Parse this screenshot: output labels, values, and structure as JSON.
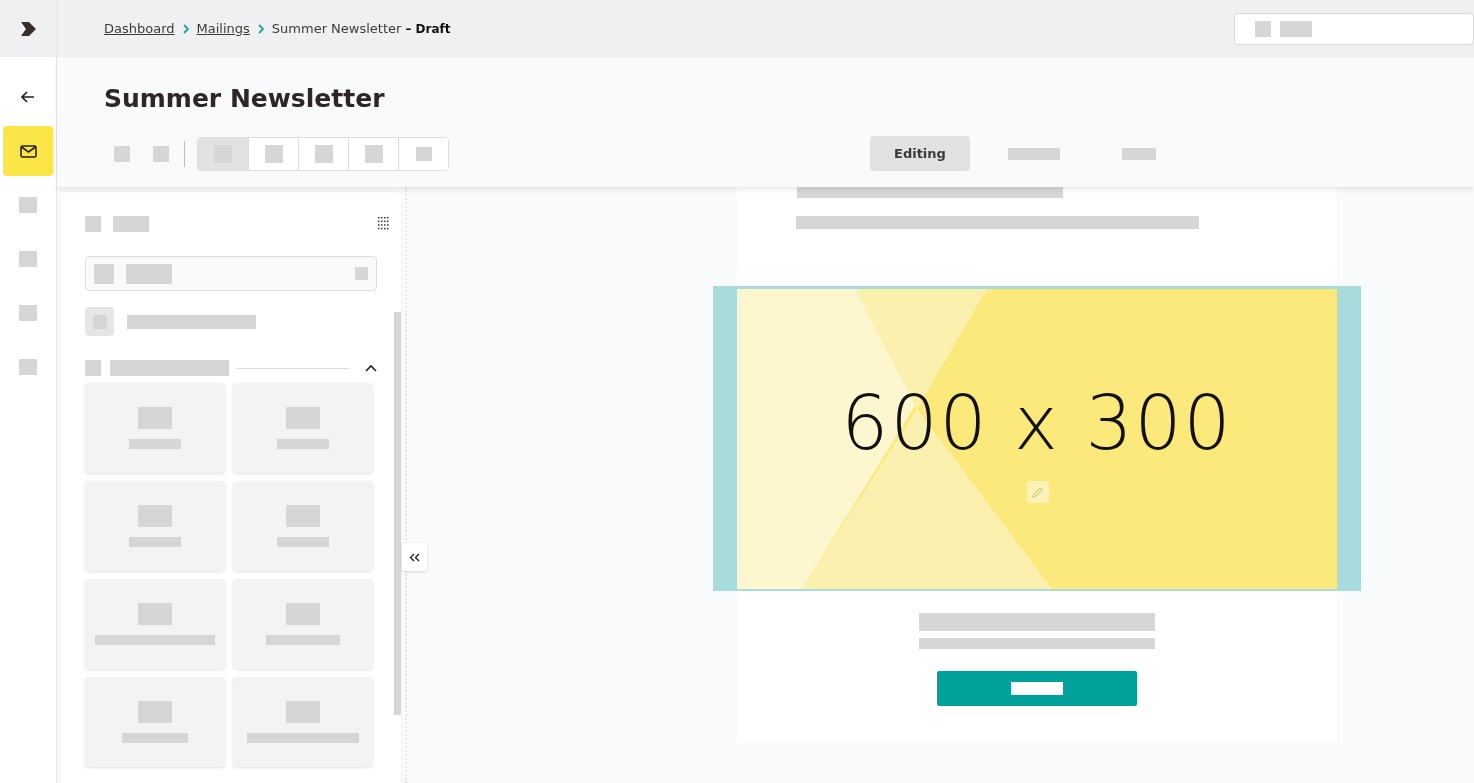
{
  "breadcrumb": {
    "links": [
      "Dashboard",
      "Mailings"
    ],
    "current": "Summer Newsletter",
    "status": "– Draft"
  },
  "rail": {
    "items": [
      {
        "kind": "back",
        "selected": false
      },
      {
        "kind": "mail",
        "selected": true
      },
      {
        "kind": "block",
        "selected": false
      },
      {
        "kind": "block",
        "selected": false
      },
      {
        "kind": "block",
        "selected": false
      },
      {
        "kind": "block",
        "selected": false
      }
    ]
  },
  "title": "Summer Newsletter",
  "segments": [
    {
      "selected": true
    },
    {
      "selected": false
    },
    {
      "selected": false
    },
    {
      "selected": false
    },
    {
      "selected": false
    }
  ],
  "tabs": [
    {
      "label": "Editing",
      "selected": true
    },
    {
      "selected": false
    },
    {
      "selected": false
    }
  ],
  "panel": {
    "option": {
      "checked": false
    },
    "section": {
      "expanded": true
    },
    "tiles": [
      {
        "kind": "tile"
      },
      {
        "kind": "tile"
      },
      {
        "kind": "tile"
      },
      {
        "kind": "tile"
      },
      {
        "kind": "tile"
      },
      {
        "kind": "tile"
      },
      {
        "kind": "tile"
      },
      {
        "kind": "tile"
      }
    ]
  },
  "canvas": {
    "image_label": "600 x 300"
  }
}
